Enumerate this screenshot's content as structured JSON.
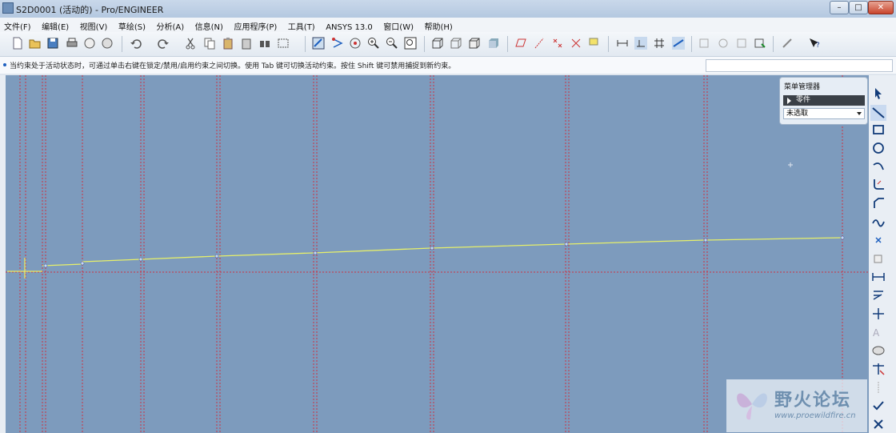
{
  "window": {
    "title": "S2D0001 (活动的) - Pro/ENGINEER",
    "minimize_label": "–",
    "maximize_label": "□",
    "close_label": "✕"
  },
  "menubar": {
    "items": [
      "文件(F)",
      "编辑(E)",
      "视图(V)",
      "草绘(S)",
      "分析(A)",
      "信息(N)",
      "应用程序(P)",
      "工具(T)",
      "ANSYS 13.0",
      "窗口(W)",
      "帮助(H)"
    ]
  },
  "toolbar": {
    "icons": [
      "new-icon",
      "open-icon",
      "save-icon",
      "print-icon",
      "send-icon",
      "email-icon",
      "undo-icon",
      "redo-icon",
      "cut-icon",
      "copy-icon",
      "paste-icon",
      "paste-special-icon",
      "regenerate-icon",
      "select-box-icon",
      "repaint-icon",
      "sketch-orient-icon",
      "spin-center-icon",
      "zoom-in-icon",
      "zoom-out-icon",
      "refit-icon",
      "wireframe-icon",
      "hidden-line-icon",
      "no-hidden-icon",
      "shaded-icon",
      "datum-plane-icon",
      "datum-axis-icon",
      "datum-point-icon",
      "coord-sys-icon",
      "annotation-icon",
      "dim-display-icon",
      "constraint-display-icon",
      "grid-display-icon",
      "vertex-display-icon",
      "model-tree-icon",
      "layers-icon",
      "properties-icon",
      "pointer-mode-icon",
      "sketcher-settings-icon",
      "context-help-icon"
    ]
  },
  "message": {
    "text": "当约束处于活动状态时，可通过单击右键在锁定/禁用/启用约束之间切换。使用 Tab 键可切换活动约束。按住 Shift 键可禁用捕捉到新约束。"
  },
  "menu_manager": {
    "title": "菜单管理器",
    "item_label": "零件",
    "select_value": "未选取"
  },
  "right_toolbar": {
    "icons": [
      "select-arrow-icon",
      "line-icon",
      "rectangle-icon",
      "circle-icon",
      "arc-icon",
      "fillet-icon",
      "chamfer-icon",
      "spline-icon",
      "point-icon",
      "offset-icon",
      "dimension-icon",
      "modify-icon",
      "constraint-icon",
      "text-icon",
      "palette-icon",
      "trim-icon",
      "mirror-icon",
      "accept-icon",
      "cancel-icon"
    ]
  },
  "watermark": {
    "title": "野火论坛",
    "url": "www.proewildfire.cn"
  },
  "colors": {
    "canvas": "#7d9bbd",
    "sketch_line": "#e6ef6a",
    "reference_line": "#cc3344",
    "accent": "#1d5fbf"
  }
}
